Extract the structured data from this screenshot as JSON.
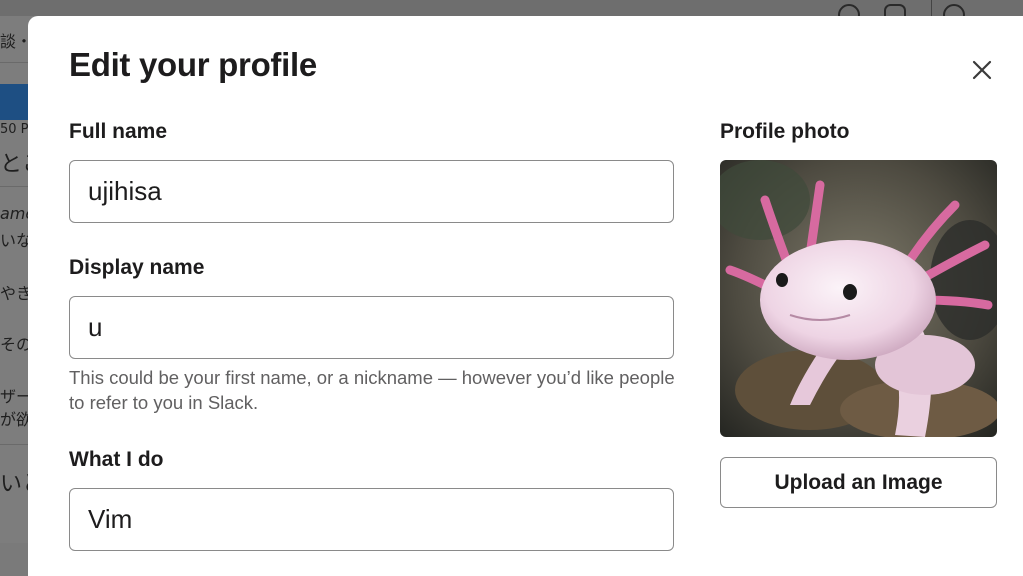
{
  "background": {
    "snippets": [
      "談・",
      "50 P",
      "とこ",
      "ame",
      "いな",
      "やきす",
      "そのみ",
      "ザー覧",
      "が欲し",
      "いと"
    ]
  },
  "modal": {
    "title": "Edit your profile",
    "close_icon": "close-icon",
    "full_name": {
      "label": "Full name",
      "value": "ujihisa"
    },
    "display_name": {
      "label": "Display name",
      "value": "u",
      "hint": "This could be your first name, or a nickname — however you’d like people to refer to you in Slack."
    },
    "what_i_do": {
      "label": "What I do",
      "value": "Vim"
    },
    "profile_photo": {
      "label": "Profile photo",
      "subject": "axolotl photo"
    },
    "upload_button": "Upload an Image"
  },
  "colors": {
    "overlay": "#7d7d7d",
    "modal_bg": "#ffffff",
    "text": "#1d1c1d",
    "hint_text": "#616061",
    "border": "#8a8a8a",
    "sidebar_accent": "#1e4f83"
  }
}
